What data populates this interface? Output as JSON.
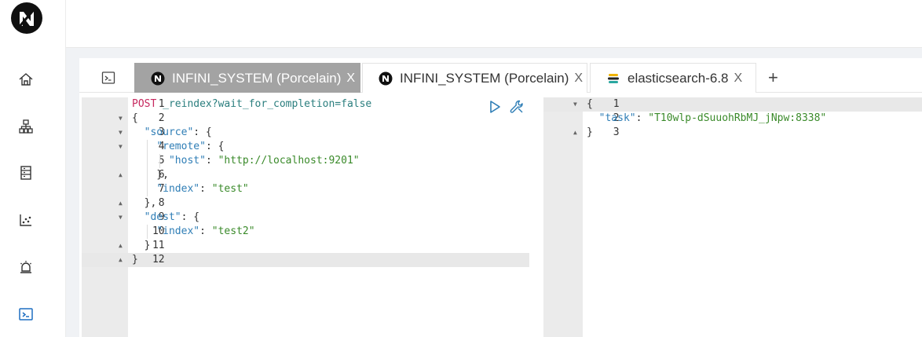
{
  "sidebar": {
    "logo": "infini-logo",
    "items": [
      {
        "icon": "home-icon"
      },
      {
        "icon": "cluster-icon"
      },
      {
        "icon": "index-icon"
      },
      {
        "icon": "chart-icon"
      },
      {
        "icon": "alert-icon"
      },
      {
        "icon": "console-icon",
        "active": true
      }
    ]
  },
  "tabs": [
    {
      "label": "INFINI_SYSTEM (Porcelain)",
      "icon": "infini-icon",
      "close": "X",
      "active": true
    },
    {
      "label": "INFINI_SYSTEM (Porcelain)",
      "icon": "infini-icon",
      "close": "X",
      "active": false
    },
    {
      "label": "elasticsearch-6.8",
      "icon": "elasticsearch-icon",
      "close": "X",
      "active": false
    }
  ],
  "add_tab_label": "+",
  "request": {
    "line_numbers": [
      "1",
      "2",
      "3",
      "4",
      "5",
      "6",
      "7",
      "8",
      "9",
      "10",
      "11",
      "12"
    ],
    "method": "POST",
    "url": "_reindex?wait_for_completion=false",
    "body": {
      "source_key": "\"source\"",
      "remote_key": "\"remote\"",
      "host_key": "\"host\"",
      "host_value": "\"http://localhost:9201\"",
      "index_key": "\"index\"",
      "index_value": "\"test\"",
      "dest_key": "\"dest\"",
      "dest_index_key": "\"index\"",
      "dest_index_value": "\"test2\""
    }
  },
  "response": {
    "line_numbers": [
      "1",
      "2",
      "3"
    ],
    "task_key": "\"task\"",
    "task_value": "\"T10wlp-dSuuohRbMJ_jNpw:8338\""
  },
  "colors": {
    "active_tab": "#a3a3a3",
    "method": "#c6285e",
    "key": "#2f7eb6",
    "string": "#3a8a2a",
    "run_button": "#2f7eb6"
  }
}
